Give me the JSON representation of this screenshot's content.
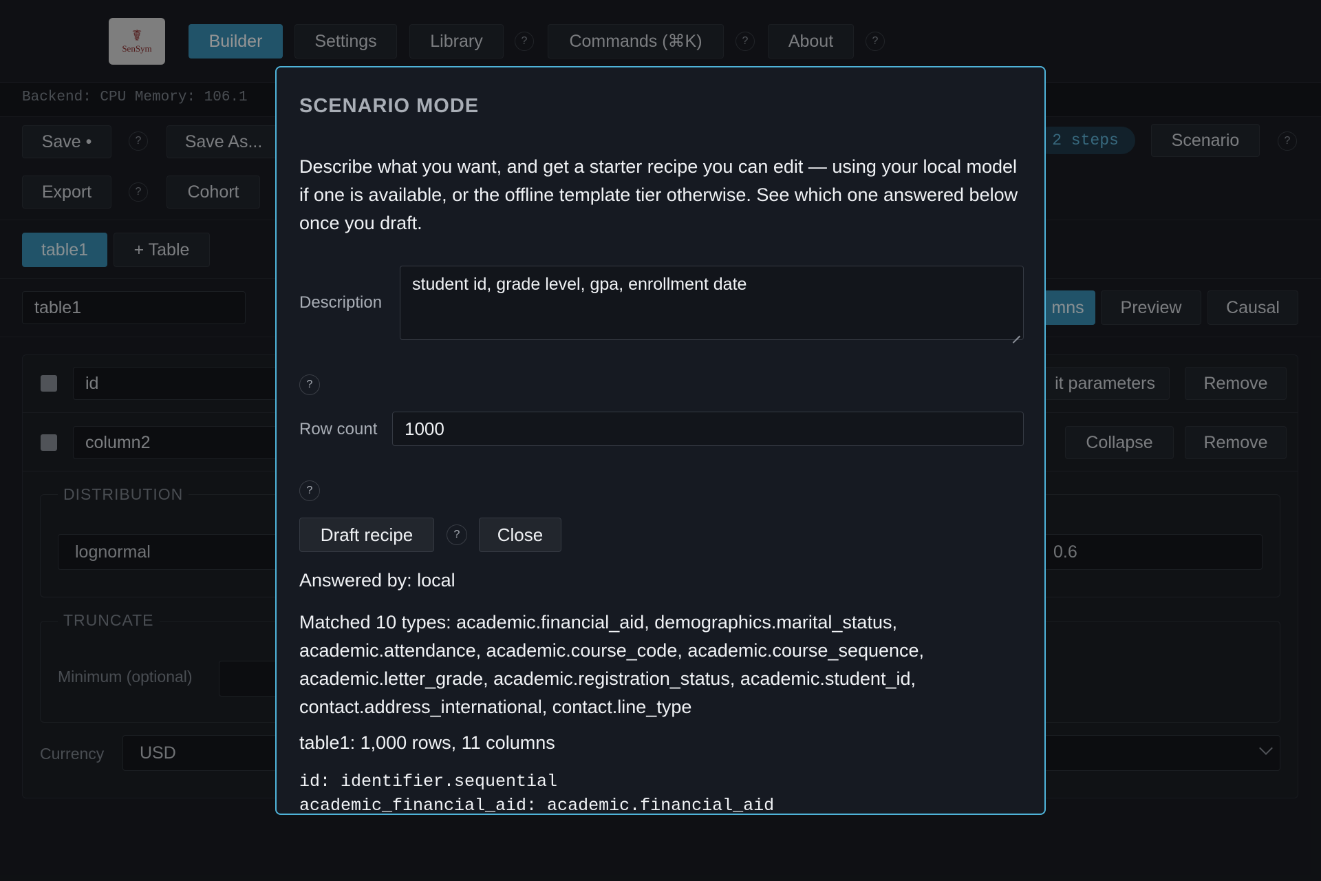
{
  "nav": {
    "logo_text": "SenSym",
    "items": [
      {
        "label": "Builder"
      },
      {
        "label": "Settings"
      },
      {
        "label": "Library"
      },
      {
        "label": "Commands (⌘K)"
      },
      {
        "label": "About"
      }
    ],
    "help_label": "?"
  },
  "status": {
    "text": "Backend: CPU  Memory: 106.1"
  },
  "toolbar": {
    "save_label": "Save •",
    "save_as_label": "Save As...",
    "export_label": "Export",
    "cohort_label": "Cohort",
    "steps_label": "2 steps",
    "scenario_label": "Scenario"
  },
  "tables": {
    "tabs": [
      {
        "label": "table1"
      }
    ],
    "add_label": "+ Table",
    "name_value": "table1",
    "view_tabs": [
      {
        "label": "mns"
      },
      {
        "label": "Preview"
      },
      {
        "label": "Causal"
      }
    ]
  },
  "columns": {
    "rows": [
      {
        "name": "id",
        "action1": "it parameters",
        "action2": "Remove"
      },
      {
        "name": "column2",
        "action1": "Collapse",
        "action2": "Remove"
      }
    ],
    "distribution_legend": "DISTRIBUTION",
    "distribution_value": "lognormal",
    "param_value": "0.6",
    "truncate_legend": "TRUNCATE",
    "minimum_label": "Minimum (optional)",
    "currency_label": "Currency",
    "currency_value": "USD"
  },
  "modal": {
    "title": "SCENARIO MODE",
    "description": "Describe what you want, and get a starter recipe you can edit — using your local model if one is available, or the offline template tier otherwise. See which one answered below once you draft.",
    "description_label": "Description",
    "description_value": "student id, grade level, gpa, enrollment date",
    "row_count_label": "Row count",
    "row_count_value": "1000",
    "draft_label": "Draft recipe",
    "close_label": "Close",
    "answered_by": "Answered by: local",
    "matched": "Matched 10 types: academic.financial_aid, demographics.marital_status, academic.attendance, academic.course_code, academic.course_sequence, academic.letter_grade, academic.registration_status, academic.student_id, contact.address_international, contact.line_type",
    "summary": "table1: 1,000 rows, 11 columns",
    "code_lines": [
      "id: identifier.sequential",
      "academic_financial_aid: academic.financial_aid"
    ]
  }
}
